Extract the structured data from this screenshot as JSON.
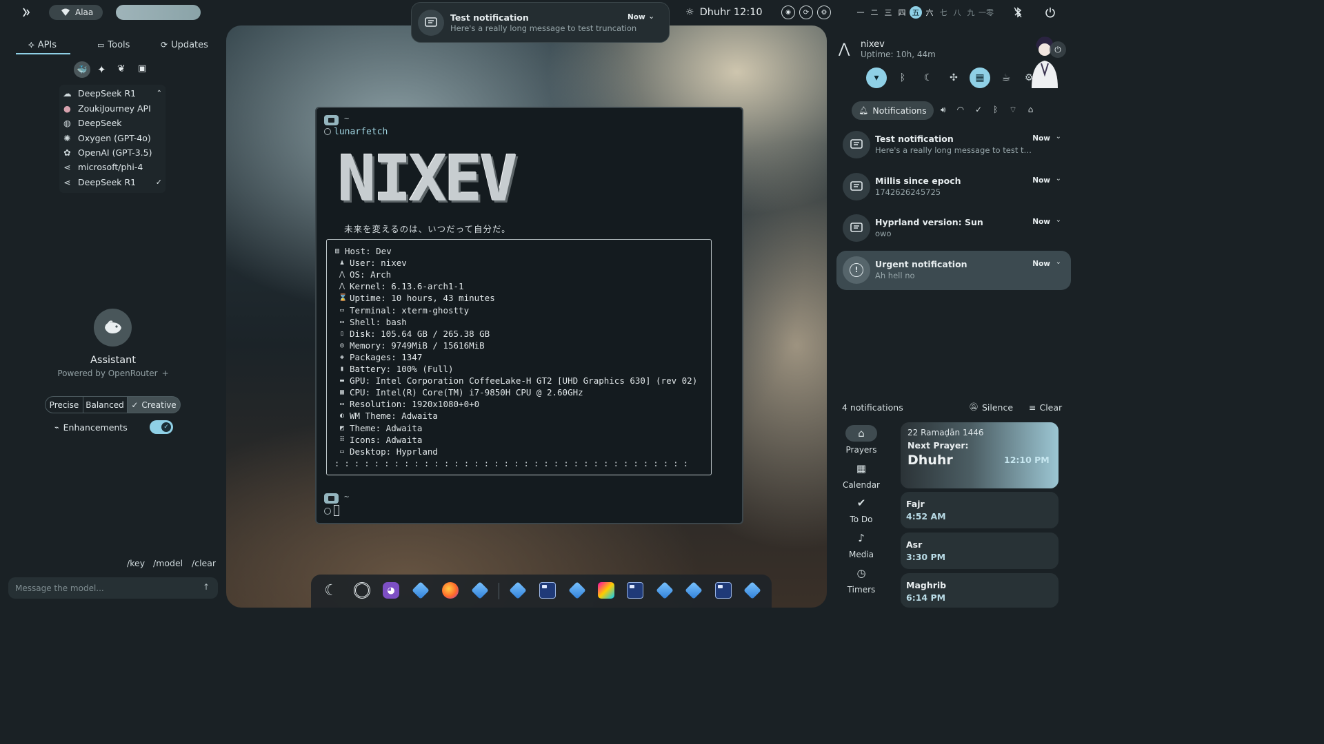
{
  "topbar": {
    "user": "Alaa",
    "prayer_label": "Dhuhr 12:10",
    "workspaces": [
      "一",
      "二",
      "三",
      "四",
      "五",
      "六",
      "七",
      "八",
      "九",
      "一零"
    ],
    "active_workspace": 4,
    "popup": {
      "title": "Test notification",
      "when": "Now",
      "body": "Here's a really long message to test truncation and …"
    }
  },
  "left": {
    "tabs": [
      {
        "label": "APIs",
        "icon": "apis-icon"
      },
      {
        "label": "Tools",
        "icon": "tools-icon"
      },
      {
        "label": "Updates",
        "icon": "updates-icon"
      }
    ],
    "selected_model": "DeepSeek R1",
    "models": [
      {
        "label": "ZoukiJourney API",
        "icon": "zouki-icon"
      },
      {
        "label": "DeepSeek",
        "icon": "deepseek-icon"
      },
      {
        "label": "Oxygen (GPT-4o)",
        "icon": "oxygen-icon"
      },
      {
        "label": "OpenAI (GPT-3.5)",
        "icon": "openai-icon"
      },
      {
        "label": "microsoft/phi-4",
        "icon": "openrouter-icon"
      },
      {
        "label": "DeepSeek R1",
        "icon": "openrouter-icon",
        "checked": true
      }
    ],
    "assistant_title": "Assistant",
    "powered_by": "Powered by OpenRouter",
    "modes": [
      "Precise",
      "Balanced",
      "Creative"
    ],
    "active_mode": "Creative",
    "enhancements_label": "Enhancements",
    "enhancements_on": true,
    "commands": [
      "/key",
      "/model",
      "/clear"
    ],
    "input_placeholder": "Message the model..."
  },
  "terminal": {
    "prompt_dir": "~",
    "command": "lunarfetch",
    "logo": "NIXEV",
    "tagline": "未来を変えるのは、いつだって自分だ。",
    "lines": [
      {
        "icon": "host-icon",
        "text": "Host: Dev"
      },
      {
        "icon": "user-icon",
        "text": "User: nixev"
      },
      {
        "icon": "os-icon",
        "text": "OS: Arch"
      },
      {
        "icon": "kernel-icon",
        "text": "Kernel: 6.13.6-arch1-1"
      },
      {
        "icon": "uptime-icon",
        "text": "Uptime: 10 hours, 43 minutes"
      },
      {
        "icon": "terminal-icon",
        "text": "Terminal: xterm-ghostty"
      },
      {
        "icon": "shell-icon",
        "text": "Shell: bash"
      },
      {
        "icon": "disk-icon",
        "text": "Disk: 105.64 GB / 265.38 GB"
      },
      {
        "icon": "memory-icon",
        "text": "Memory: 9749MiB / 15616MiB"
      },
      {
        "icon": "packages-icon",
        "text": "Packages: 1347"
      },
      {
        "icon": "battery-icon",
        "text": "Battery: 100% (Full)"
      },
      {
        "icon": "gpu-icon",
        "text": "GPU: Intel Corporation CoffeeLake-H GT2 [UHD Graphics 630] (rev 02)"
      },
      {
        "icon": "cpu-icon",
        "text": "CPU: Intel(R) Core(TM) i7-9850H CPU @ 2.60GHz"
      },
      {
        "icon": "resolution-icon",
        "text": "Resolution: 1920x1080+0+0"
      },
      {
        "icon": "wm-theme-icon",
        "text": "WM Theme: Adwaita"
      },
      {
        "icon": "theme-icon",
        "text": "Theme: Adwaita"
      },
      {
        "icon": "icons-icon",
        "text": "Icons: Adwaita"
      },
      {
        "icon": "desktop-icon",
        "text": "Desktop: Hyprland"
      }
    ],
    "dots": ": : : : : : : : : : : : : : : : : : : : : : : : : : : : : : : : : : : :"
  },
  "right": {
    "username": "nixev",
    "uptime": "Uptime: 10h, 44m",
    "notifications_tab": "Notifications",
    "notifications": [
      {
        "title": "Test notification",
        "body": "Here's a really long message to test truncatio...",
        "when": "Now"
      },
      {
        "title": "Millis since epoch",
        "body": "1742626245725",
        "when": "Now"
      },
      {
        "title": "Hyprland version: Sun",
        "body": "owo",
        "when": "Now"
      },
      {
        "title": "Urgent notification",
        "body": "Ah hell no",
        "when": "Now",
        "urgent": true
      }
    ],
    "count_label": "4 notifications",
    "silence_label": "Silence",
    "clear_label": "Clear",
    "side_tabs": [
      {
        "label": "Prayers",
        "icon": "mosque-icon"
      },
      {
        "label": "Calendar",
        "icon": "calendar-icon"
      },
      {
        "label": "To Do",
        "icon": "check-icon"
      },
      {
        "label": "Media",
        "icon": "music-note-icon"
      },
      {
        "label": "Timers",
        "icon": "clock-icon"
      }
    ],
    "hijri_date": "22 Ramaḍān 1446",
    "next_prayer_label": "Next Prayer:",
    "next_prayer": "Dhuhr",
    "next_prayer_time": "12:10 PM",
    "prayers": [
      {
        "name": "Fajr",
        "time": "4:52 AM"
      },
      {
        "name": "Asr",
        "time": "3:30 PM"
      },
      {
        "name": "Maghrib",
        "time": "6:14 PM"
      }
    ]
  },
  "colors": {
    "accent": "#8fd0e6",
    "panel": "#1a2125",
    "card": "#283236",
    "urgent": "#3c4a50"
  }
}
